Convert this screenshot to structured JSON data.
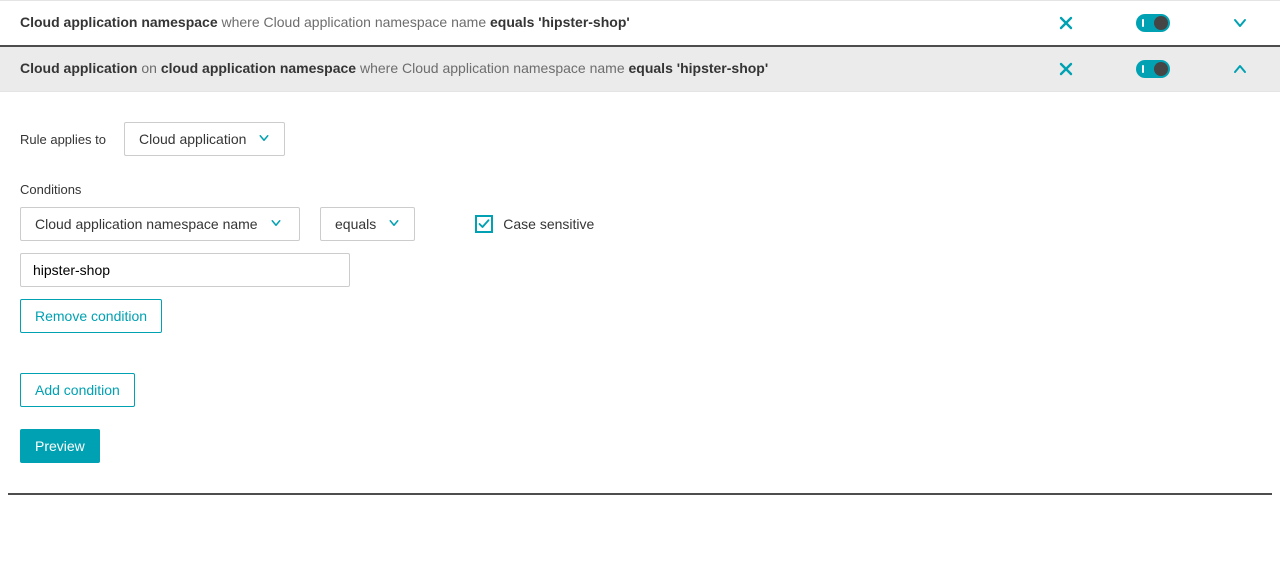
{
  "rules": [
    {
      "title_strong1": "Cloud application namespace",
      "where": "where",
      "attr": "Cloud application namespace name",
      "op": "equals",
      "value": "'hipster-shop'",
      "expanded": false,
      "enabled": true
    },
    {
      "title_strong1": "Cloud application",
      "on": "on",
      "title_strong2": "cloud application namespace",
      "where": "where",
      "attr": "Cloud application namespace name",
      "op": "equals",
      "value": "'hipster-shop'",
      "expanded": true,
      "enabled": true
    }
  ],
  "panel": {
    "rule_applies_label": "Rule applies to",
    "rule_applies_value": "Cloud application",
    "conditions_label": "Conditions",
    "attribute_value": "Cloud application namespace name",
    "operator_value": "equals",
    "case_sensitive_label": "Case sensitive",
    "case_sensitive_checked": true,
    "match_value": "hipster-shop",
    "remove_condition_label": "Remove condition",
    "add_condition_label": "Add condition",
    "preview_label": "Preview"
  }
}
